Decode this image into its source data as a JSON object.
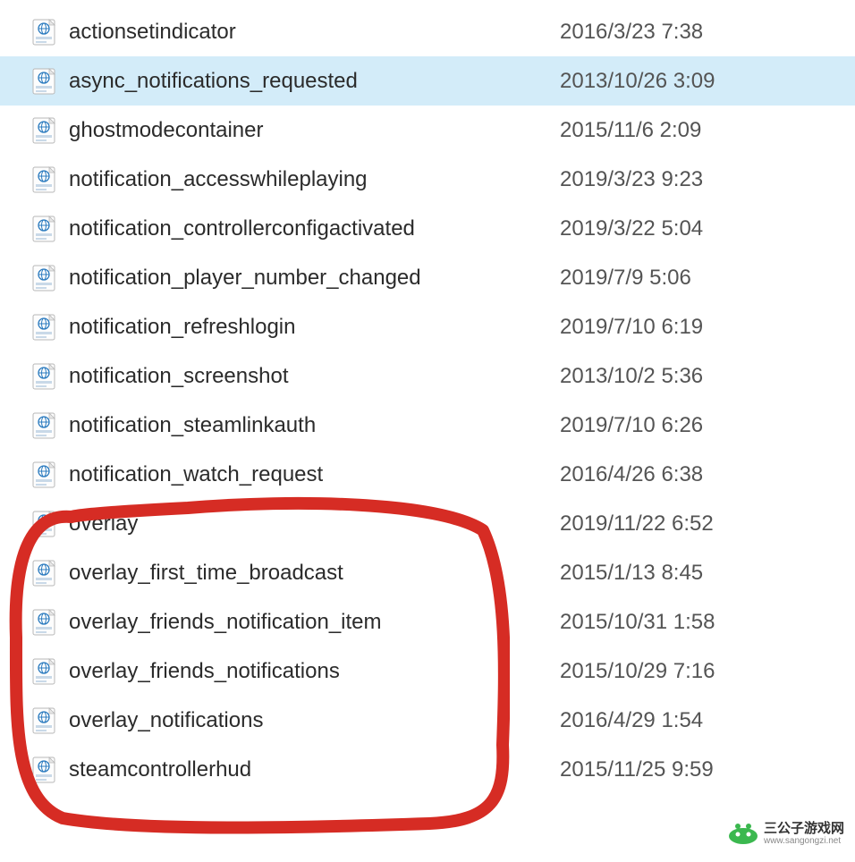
{
  "files": [
    {
      "name": "actionsetindicator",
      "date": "2016/3/23 7:38",
      "selected": false
    },
    {
      "name": "async_notifications_requested",
      "date": "2013/10/26 3:09",
      "selected": true
    },
    {
      "name": "ghostmodecontainer",
      "date": "2015/11/6 2:09",
      "selected": false
    },
    {
      "name": "notification_accesswhileplaying",
      "date": "2019/3/23 9:23",
      "selected": false
    },
    {
      "name": "notification_controllerconfigactivated",
      "date": "2019/3/22 5:04",
      "selected": false
    },
    {
      "name": "notification_player_number_changed",
      "date": "2019/7/9 5:06",
      "selected": false
    },
    {
      "name": "notification_refreshlogin",
      "date": "2019/7/10 6:19",
      "selected": false
    },
    {
      "name": "notification_screenshot",
      "date": "2013/10/2 5:36",
      "selected": false
    },
    {
      "name": "notification_steamlinkauth",
      "date": "2019/7/10 6:26",
      "selected": false
    },
    {
      "name": "notification_watch_request",
      "date": "2016/4/26 6:38",
      "selected": false
    },
    {
      "name": "overlay",
      "date": "2019/11/22 6:52",
      "selected": false
    },
    {
      "name": "overlay_first_time_broadcast",
      "date": "2015/1/13 8:45",
      "selected": false
    },
    {
      "name": "overlay_friends_notification_item",
      "date": "2015/10/31 1:58",
      "selected": false
    },
    {
      "name": "overlay_friends_notifications",
      "date": "2015/10/29 7:16",
      "selected": false
    },
    {
      "name": "overlay_notifications",
      "date": "2016/4/29 1:54",
      "selected": false
    },
    {
      "name": "steamcontrollerhud",
      "date": "2015/11/25 9:59",
      "selected": false
    }
  ],
  "icon_type": "html-file-icon",
  "annotation_color": "#d62c24",
  "watermark": {
    "title": "三公子游戏网",
    "url": "www.sangongzi.net",
    "logo_color": "#3bb84f"
  }
}
